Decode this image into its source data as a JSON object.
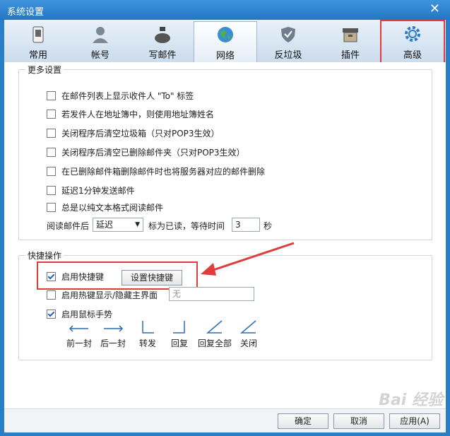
{
  "window": {
    "title": "系统设置",
    "close_glyph": "✕"
  },
  "tabs": [
    {
      "label": "常用",
      "icon": "phone-icon"
    },
    {
      "label": "帐号",
      "icon": "user-icon"
    },
    {
      "label": "写邮件",
      "icon": "inkjar-icon"
    },
    {
      "label": "网络",
      "icon": "globe-icon"
    },
    {
      "label": "反垃圾",
      "icon": "shield-icon"
    },
    {
      "label": "插件",
      "icon": "box-icon"
    },
    {
      "label": "高级",
      "icon": "gear-icon"
    }
  ],
  "more_settings": {
    "legend": "更多设置",
    "options": [
      {
        "label": "在邮件列表上显示收件人 \"To\" 标签",
        "checked": false
      },
      {
        "label": "若发件人在地址簿中，则使用地址簿姓名",
        "checked": false
      },
      {
        "label": "关闭程序后清空垃圾箱（只对POP3生效）",
        "checked": false
      },
      {
        "label": "关闭程序后清空已删除邮件夹（只对POP3生效）",
        "checked": false
      },
      {
        "label": "在已删除邮件箱删除邮件时也将服务器对应的邮件删除",
        "checked": false
      },
      {
        "label": "延迟1分钟发送邮件",
        "checked": false
      },
      {
        "label": "总是以纯文本格式阅读邮件",
        "checked": false
      }
    ],
    "read_prefix": "阅读邮件后",
    "read_select_value": "延迟",
    "read_mid": "标为已读，等待时间",
    "read_wait_value": "3",
    "read_unit": "秒"
  },
  "shortcuts": {
    "legend": "快捷操作",
    "enable_hotkeys_label": "启用快捷键",
    "enable_hotkeys_checked": true,
    "set_hotkeys_button": "设置快捷键",
    "hotkey_show_hide_label": "启用热键显示/隐藏主界面",
    "hotkey_show_hide_checked": false,
    "hotkey_value": "无",
    "mouse_gesture_label": "启用鼠标手势",
    "mouse_gesture_checked": true,
    "gestures": [
      "前一封",
      "后一封",
      "转发",
      "回复",
      "回复全部",
      "关闭"
    ]
  },
  "footer": {
    "ok": "确定",
    "cancel": "取消",
    "apply": "应用(A)"
  },
  "watermark": "Bai 经验",
  "colors": {
    "highlight_red": "#e23b3b",
    "title_blue": "#2a7dc7"
  }
}
